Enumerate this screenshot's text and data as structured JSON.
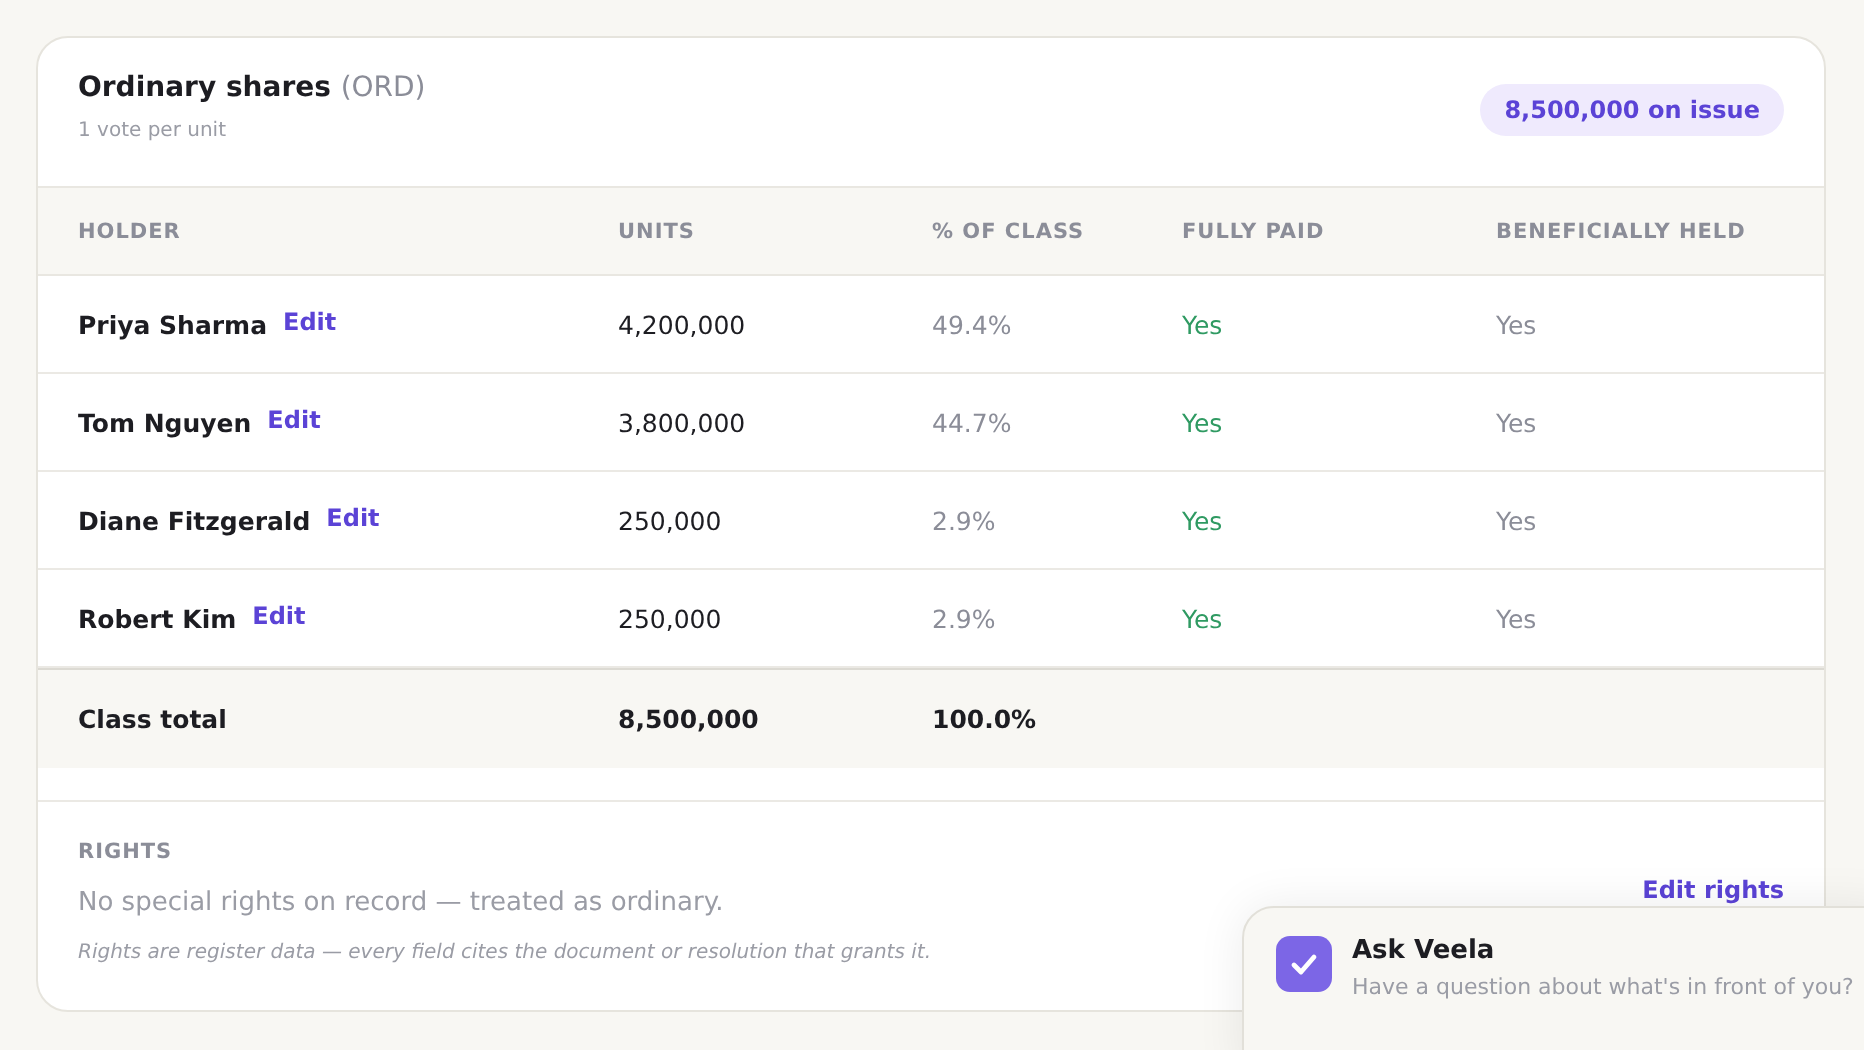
{
  "share_class": {
    "title": "Ordinary shares",
    "code": "(ORD)",
    "subtitle": "1 vote per unit",
    "badge": "8,500,000 on issue"
  },
  "table": {
    "columns": [
      "HOLDER",
      "UNITS",
      "% OF CLASS",
      "FULLY PAID",
      "BENEFICIALLY HELD"
    ],
    "rows": [
      {
        "holder": "Priya Sharma",
        "edit": "Edit",
        "units": "4,200,000",
        "percent": "49.4%",
        "fully_paid": "Yes",
        "beneficially_held": "Yes"
      },
      {
        "holder": "Tom Nguyen",
        "edit": "Edit",
        "units": "3,800,000",
        "percent": "44.7%",
        "fully_paid": "Yes",
        "beneficially_held": "Yes"
      },
      {
        "holder": "Diane Fitzgerald",
        "edit": "Edit",
        "units": "250,000",
        "percent": "2.9%",
        "fully_paid": "Yes",
        "beneficially_held": "Yes"
      },
      {
        "holder": "Robert Kim",
        "edit": "Edit",
        "units": "250,000",
        "percent": "2.9%",
        "fully_paid": "Yes",
        "beneficially_held": "Yes"
      }
    ],
    "total": {
      "label": "Class total",
      "units": "8,500,000",
      "percent": "100.0%"
    }
  },
  "rights": {
    "heading": "RIGHTS",
    "text": "No special rights on record — treated as ordinary.",
    "edit_link": "Edit rights",
    "note": "Rights are register data — every field cites the document or resolution that grants it."
  },
  "assistant": {
    "title": "Ask Veela",
    "subtitle": "Have a question about what's in front of you?"
  }
}
